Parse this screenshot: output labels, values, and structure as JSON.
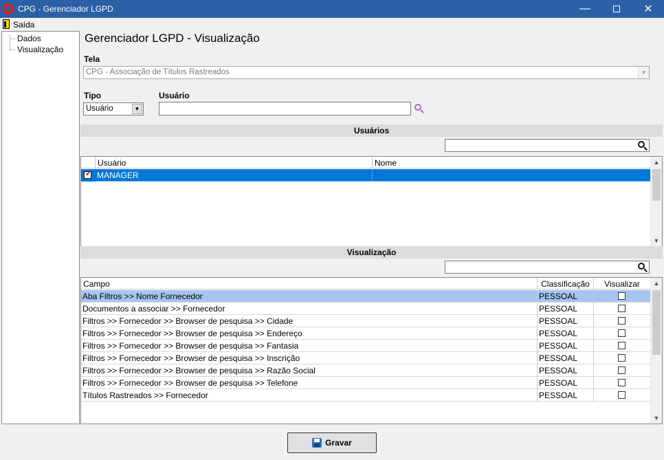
{
  "window": {
    "title": "CPG - Gerenciador LGPD"
  },
  "menu": {
    "exit_label": "Saída"
  },
  "tree": {
    "items": [
      "Dados",
      "Visualização"
    ]
  },
  "page": {
    "heading": "Gerenciador LGPD - Visualização"
  },
  "tela": {
    "label": "Tela",
    "value": "CPG - Associação de Títulos Rastreados"
  },
  "tipo": {
    "label": "Tipo",
    "value": "Usuário"
  },
  "usuario_field": {
    "label": "Usuário",
    "value": ""
  },
  "users_section": {
    "title": "Usuários",
    "filter_value": "",
    "columns": [
      "Usuário",
      "Nome"
    ],
    "rows": [
      {
        "checked": true,
        "usuario": "MANAGER",
        "nome": ""
      }
    ]
  },
  "view_section": {
    "title": "Visualização",
    "filter_value": "",
    "columns": [
      "Campo",
      "Classificação",
      "Visualizar"
    ],
    "rows": [
      {
        "campo": "Aba Filtros >> Nome Fornecedor",
        "classificacao": "PESSOAL",
        "visualizar": false
      },
      {
        "campo": "Documentos a associar >> Fornecedor",
        "classificacao": "PESSOAL",
        "visualizar": false
      },
      {
        "campo": "Filtros >> Fornecedor  >> Browser de pesquisa >> Cidade",
        "classificacao": "PESSOAL",
        "visualizar": false
      },
      {
        "campo": "Filtros >> Fornecedor  >> Browser de pesquisa >> Endereço",
        "classificacao": "PESSOAL",
        "visualizar": false
      },
      {
        "campo": "Filtros >> Fornecedor  >> Browser de pesquisa >> Fantasia",
        "classificacao": "PESSOAL",
        "visualizar": false
      },
      {
        "campo": "Filtros >> Fornecedor  >> Browser de pesquisa >> Inscrição",
        "classificacao": "PESSOAL",
        "visualizar": false
      },
      {
        "campo": "Filtros >> Fornecedor  >> Browser de pesquisa >> Razão Social",
        "classificacao": "PESSOAL",
        "visualizar": false
      },
      {
        "campo": "Filtros >> Fornecedor  >> Browser de pesquisa >> Telefone",
        "classificacao": "PESSOAL",
        "visualizar": false
      },
      {
        "campo": "Títulos Rastreados >> Fornecedor",
        "classificacao": "PESSOAL",
        "visualizar": false
      }
    ]
  },
  "footer": {
    "save_label": "Gravar"
  },
  "colors": {
    "titlebar": "#2b5fa6",
    "selection": "#0078d7",
    "selection_light": "#a6c4ef",
    "section_bar": "#dcdcdc"
  }
}
